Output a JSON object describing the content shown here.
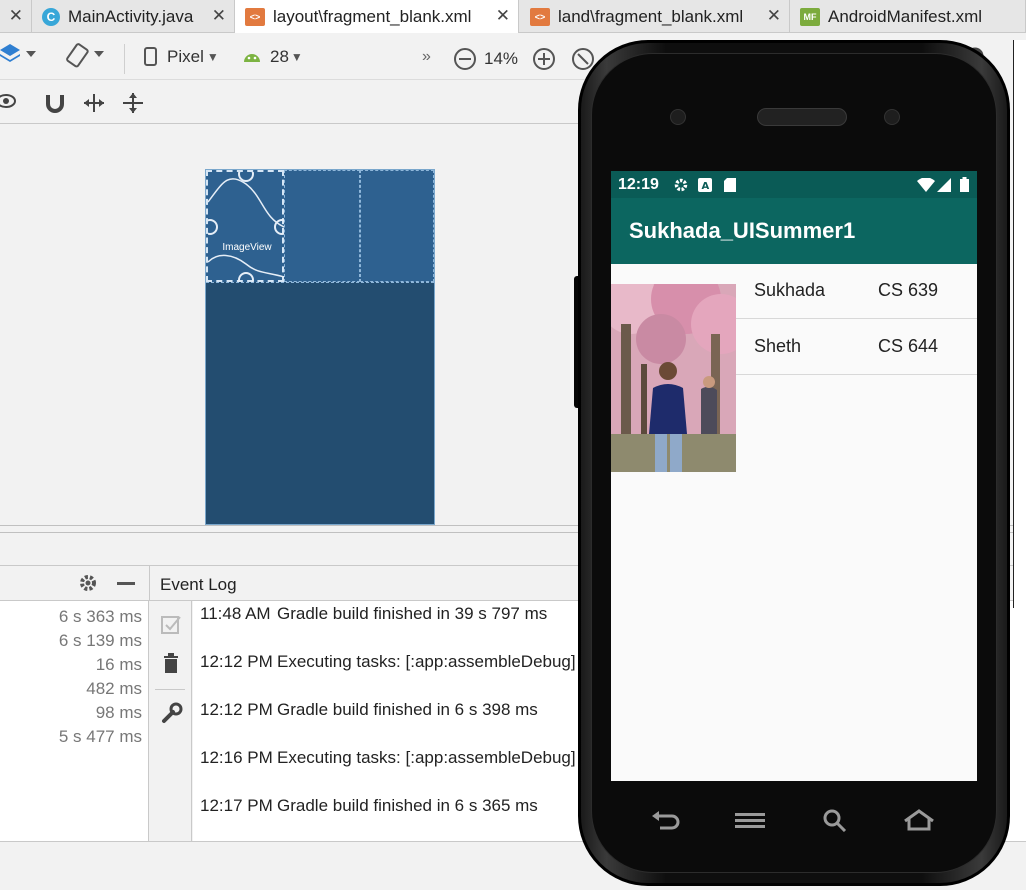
{
  "tabs": [
    {
      "label": "MainActivity.java",
      "icon": "java-class-icon"
    },
    {
      "label": "layout\\fragment_blank.xml",
      "icon": "xml-layout-icon"
    },
    {
      "label": "land\\fragment_blank.xml",
      "icon": "xml-layout-icon"
    },
    {
      "label": "AndroidManifest.xml",
      "icon": "manifest-icon"
    }
  ],
  "toolbar": {
    "device": "Pixel",
    "api": "28",
    "zoom": "14%"
  },
  "design": {
    "imageview_label": "ImageView"
  },
  "event_log": {
    "title": "Event Log",
    "durations": [
      "6 s 363 ms",
      "6 s 139 ms",
      "16 ms",
      "482 ms",
      "98 ms",
      "5 s 477 ms"
    ],
    "entries": [
      {
        "time": "11:48 AM",
        "msg": "Gradle build finished in 39 s 797 ms"
      },
      {
        "time": "12:12 PM",
        "msg": "Executing tasks: [:app:assembleDebug]"
      },
      {
        "time": "12:12 PM",
        "msg": "Gradle build finished in 6 s 398 ms"
      },
      {
        "time": "12:16 PM",
        "msg": "Executing tasks: [:app:assembleDebug]"
      },
      {
        "time": "12:17 PM",
        "msg": "Gradle build finished in 6 s 365 ms"
      }
    ]
  },
  "phone": {
    "status_time": "12:19",
    "app_title": "Sukhada_UISummer1",
    "rows": [
      {
        "name": "Sukhada",
        "course": "CS 639"
      },
      {
        "name": "Sheth",
        "course": "CS 644"
      }
    ]
  },
  "colors": {
    "app_bar": "#0c6660",
    "status_bar": "#0a5b56",
    "blueprint": "#245073"
  }
}
